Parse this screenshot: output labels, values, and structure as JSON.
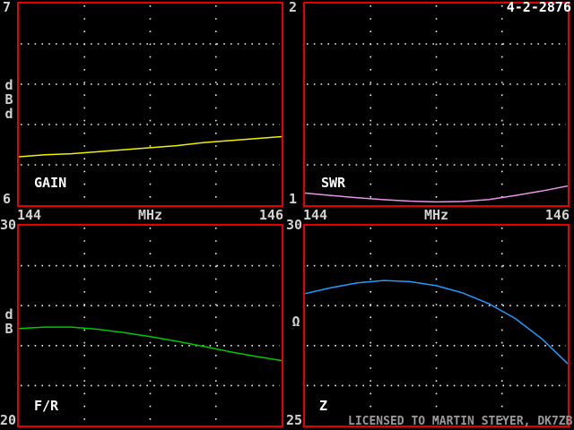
{
  "window": {
    "date_stamp": "4-2-2876",
    "license_text": "LICENSED TO MARTIN STEYER, DK7ZB"
  },
  "colors": {
    "border": "#e80000",
    "background": "#000000",
    "grid_dots": "#f2f2f2",
    "axis_text": "#d2d2d2",
    "panel_label_text": "#ffffff",
    "license_text": "#9a9a9a",
    "gain_curve": "#f0f000",
    "swr_curve": "#e892e8",
    "fr_curve": "#00c800",
    "z_curve": "#1f9bff"
  },
  "axis": {
    "x_left": "144",
    "x_mid": "MHz",
    "x_right": "146"
  },
  "chart_data": [
    {
      "id": "gain",
      "type": "line",
      "title": "GAIN",
      "ylabel": "dBd",
      "ylabel_chars": [
        "d",
        "B",
        "d"
      ],
      "xlabel": "MHz",
      "color": "#f0f000",
      "xlim": [
        144,
        146
      ],
      "ylim": [
        6,
        7
      ],
      "ytick_top": "7",
      "ytick_bottom": "6",
      "xtick_left": "144",
      "xtick_right": "146",
      "grid": "dotted",
      "x": [
        144,
        144.2,
        144.4,
        144.6,
        144.8,
        145,
        145.2,
        145.4,
        145.6,
        145.8,
        146
      ],
      "values": [
        6.24,
        6.25,
        6.255,
        6.265,
        6.275,
        6.285,
        6.295,
        6.31,
        6.32,
        6.33,
        6.34
      ]
    },
    {
      "id": "swr",
      "type": "line",
      "title": "SWR",
      "ylabel": "",
      "ylabel_chars": [],
      "xlabel": "MHz",
      "color": "#e892e8",
      "xlim": [
        144,
        146
      ],
      "ylim": [
        1,
        2
      ],
      "ytick_top": "2",
      "ytick_bottom": "1",
      "xtick_left": "144",
      "xtick_right": "146",
      "grid": "dotted",
      "x": [
        144,
        144.2,
        144.4,
        144.6,
        144.8,
        145,
        145.2,
        145.4,
        145.6,
        145.8,
        146
      ],
      "values": [
        1.06,
        1.048,
        1.037,
        1.027,
        1.02,
        1.016,
        1.018,
        1.028,
        1.048,
        1.07,
        1.095
      ]
    },
    {
      "id": "fr",
      "type": "line",
      "title": "F/R",
      "ylabel": "dB",
      "ylabel_chars": [
        "d",
        "B"
      ],
      "xlabel": "",
      "color": "#00c800",
      "xlim": [
        144,
        146
      ],
      "ylim": [
        20,
        30
      ],
      "ytick_top": "30",
      "ytick_bottom": "20",
      "grid": "dotted",
      "x": [
        144,
        144.2,
        144.4,
        144.6,
        144.8,
        145,
        145.2,
        145.4,
        145.6,
        145.8,
        146
      ],
      "values": [
        24.85,
        24.93,
        24.93,
        24.82,
        24.65,
        24.45,
        24.22,
        23.97,
        23.7,
        23.46,
        23.25
      ]
    },
    {
      "id": "z",
      "type": "line",
      "title": "Z",
      "ylabel": "Ω",
      "ylabel_chars": [
        "Ω"
      ],
      "xlabel": "",
      "color": "#1f9bff",
      "xlim": [
        144,
        146
      ],
      "ylim": [
        25,
        30
      ],
      "ytick_top": "30",
      "ytick_bottom": "25",
      "grid": "dotted",
      "x": [
        144,
        144.2,
        144.4,
        144.6,
        144.8,
        145,
        145.2,
        145.4,
        145.6,
        145.8,
        146
      ],
      "values": [
        28.3,
        28.45,
        28.57,
        28.63,
        28.6,
        28.5,
        28.32,
        28.05,
        27.68,
        27.18,
        26.55
      ]
    }
  ]
}
